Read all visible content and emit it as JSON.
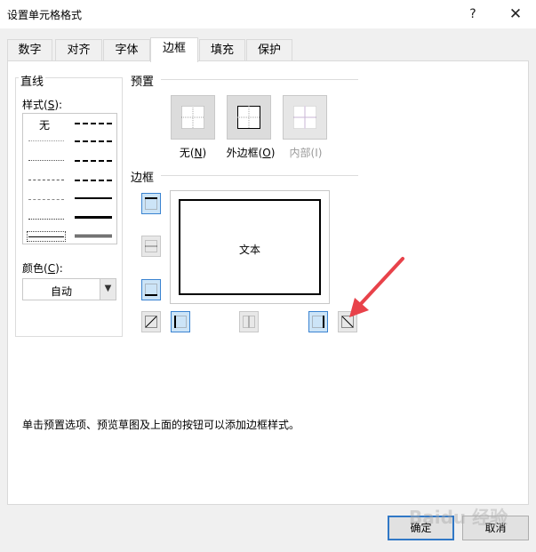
{
  "window": {
    "title": "设置单元格格式",
    "help_label": "?",
    "close_label": "✕"
  },
  "tabs": [
    {
      "label": "数字",
      "active": false
    },
    {
      "label": "对齐",
      "active": false
    },
    {
      "label": "字体",
      "active": false
    },
    {
      "label": "边框",
      "active": true
    },
    {
      "label": "填充",
      "active": false
    },
    {
      "label": "保护",
      "active": false
    }
  ],
  "line_group": {
    "title": "直线",
    "style_label": "样式(",
    "style_key": "S",
    "style_suffix": "):",
    "none_label": "无",
    "color_label": "颜色(",
    "color_key": "C",
    "color_suffix": "):",
    "color_value": "自动"
  },
  "presets": {
    "title": "预置",
    "items": [
      {
        "label": "无(",
        "key": "N",
        "suffix": ")",
        "enabled": true
      },
      {
        "label": "外边框(",
        "key": "O",
        "suffix": ")",
        "enabled": true
      },
      {
        "label": "内部(I)",
        "key": "",
        "suffix": "",
        "enabled": false
      }
    ]
  },
  "border": {
    "title": "边框",
    "preview_text": "文本"
  },
  "hint": "单击预置选项、预览草图及上面的按钮可以添加边框样式。",
  "buttons": {
    "ok": "确定",
    "cancel": "取消"
  },
  "watermark": "Baidu 经验",
  "colors": {
    "active_button_bg": "#cce4f7",
    "active_button_border": "#3b84d1",
    "arrow": "#e8424a",
    "primary_border": "#3178c6"
  }
}
